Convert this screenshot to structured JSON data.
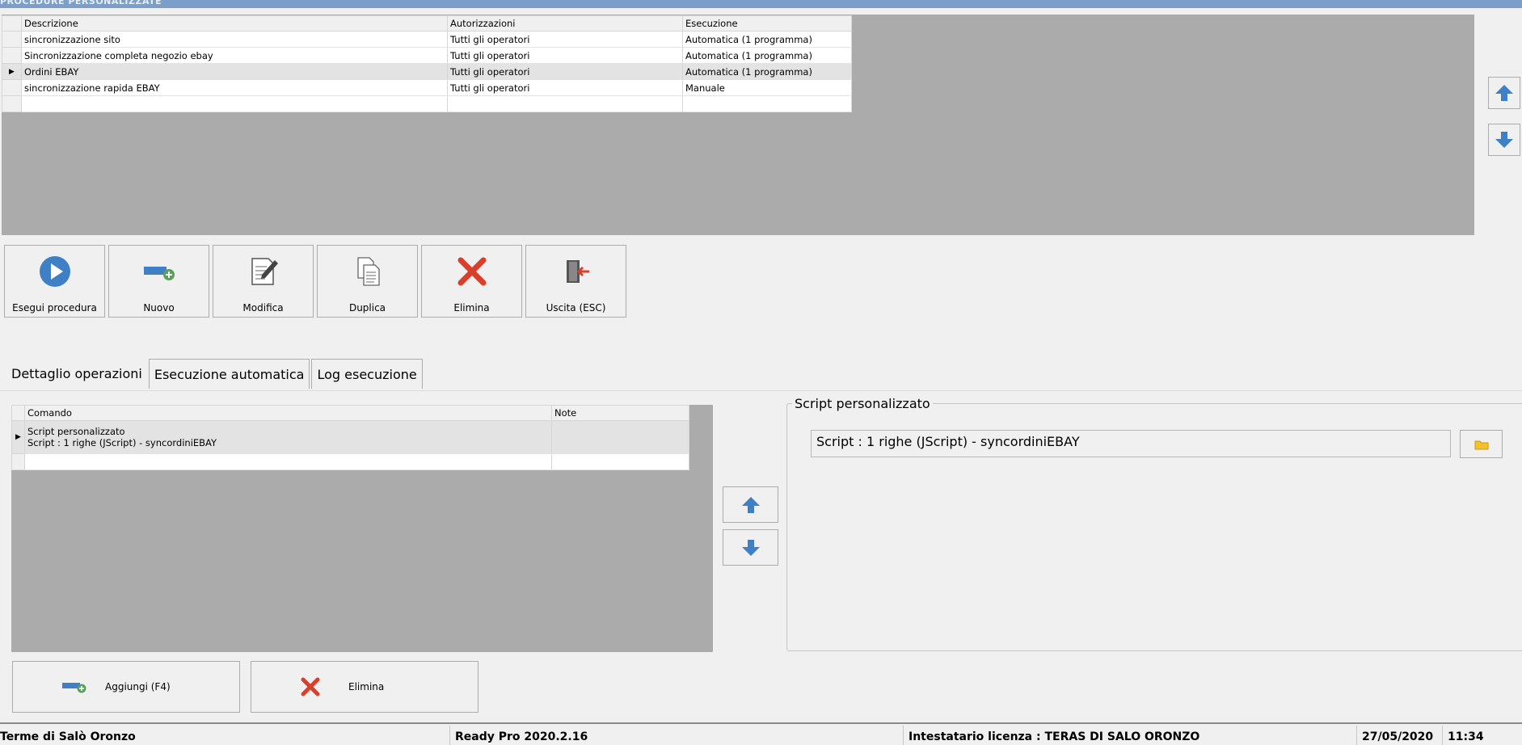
{
  "window": {
    "title": "PROCEDURE PERSONALIZZATE"
  },
  "procedures": {
    "columns": [
      "Descrizione",
      "Autorizzazioni",
      "Esecuzione"
    ],
    "rows": [
      {
        "descrizione": "sincronizzazione sito",
        "autorizzazioni": "Tutti gli operatori",
        "esecuzione": "Automatica (1 programma)"
      },
      {
        "descrizione": "Sincronizzazione completa  negozio ebay",
        "autorizzazioni": "Tutti gli operatori",
        "esecuzione": "Automatica (1 programma)"
      },
      {
        "descrizione": "Ordini EBAY",
        "autorizzazioni": "Tutti gli operatori",
        "esecuzione": "Automatica (1 programma)"
      },
      {
        "descrizione": "sincronizzazione rapida EBAY",
        "autorizzazioni": "Tutti gli operatori",
        "esecuzione": "Manuale"
      }
    ],
    "selected_row_indicator": "▶"
  },
  "toolbar": {
    "run_label": "Esegui procedura",
    "new_label": "Nuovo",
    "edit_label": "Modifica",
    "duplicate_label": "Duplica",
    "delete_label": "Elimina",
    "exit_label": "Uscita (ESC)"
  },
  "tabs": [
    "Dettaglio operazioni",
    "Esecuzione automatica",
    "Log esecuzione"
  ],
  "operations": {
    "columns": [
      "Comando",
      "Note"
    ],
    "rows": [
      {
        "comando_line1": "Script personalizzato",
        "comando_line2": "Script : 1 righe (JScript) - syncordiniEBAY",
        "note": ""
      }
    ],
    "selected_row_indicator": "▶"
  },
  "script_group": {
    "legend": "Script personalizzato",
    "value": "Script : 1 righe (JScript) - syncordiniEBAY"
  },
  "bottom_buttons": {
    "add_label": "Aggiungi (F4)",
    "delete_label": "Elimina"
  },
  "statusbar": {
    "company": "Terme di Salò Oronzo",
    "product": "Ready Pro 2020.2.16",
    "license": "Intestatario licenza : TERAS DI SALO ORONZO",
    "date": "27/05/2020",
    "time": "11:34"
  },
  "colors": {
    "accent_blue": "#3f7fc6",
    "delete_red": "#d9402c",
    "title_bar": "#7b9fc9",
    "grid_gray": "#ababab"
  },
  "icons": {
    "run": "play-icon",
    "new": "add-record-icon",
    "edit": "edit-document-icon",
    "duplicate": "copy-documents-icon",
    "delete": "delete-x-icon",
    "exit": "exit-door-icon",
    "up": "arrow-up-icon",
    "down": "arrow-down-icon",
    "browse": "folder-icon"
  }
}
